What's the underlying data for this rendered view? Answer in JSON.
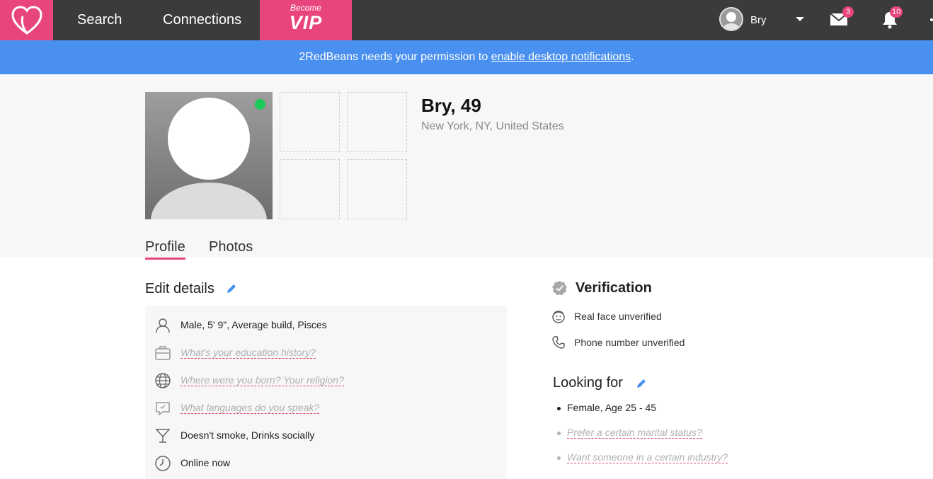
{
  "nav": {
    "logo_icon": "heart-logo-icon",
    "search_label": "Search",
    "connections_label": "Connections",
    "vip_small": "Become",
    "vip_big": "VIP",
    "user_name": "Bry",
    "messages_count": "3",
    "notifications_count": "10",
    "brand_color": "#e8457f",
    "bar_color": "#3b3b3b"
  },
  "banner": {
    "text_before": "2RedBeans needs your permission to ",
    "link_text": "enable desktop notifications",
    "text_after": ".",
    "color": "#4a90f0"
  },
  "profile": {
    "name_age": "Bry, 49",
    "location": "New York, NY, United States",
    "online": true
  },
  "tabs": [
    {
      "label": "Profile",
      "active": true
    },
    {
      "label": "Photos",
      "active": false
    }
  ],
  "details": {
    "title": "Edit details",
    "rows": [
      {
        "icon": "person-icon",
        "text": "Male, 5' 9\", Average build, Pisces",
        "prompt": false
      },
      {
        "icon": "briefcase-icon",
        "text": "What's your education history?",
        "prompt": true
      },
      {
        "icon": "globe-icon",
        "text": "Where were you born? Your religion?",
        "prompt": true
      },
      {
        "icon": "chat-bubble-icon",
        "text": "What languages do you speak?",
        "prompt": true
      },
      {
        "icon": "cocktail-icon",
        "text": "Doesn't smoke, Drinks socially",
        "prompt": false
      },
      {
        "icon": "clock-icon",
        "text": "Online now",
        "prompt": false
      }
    ]
  },
  "verification": {
    "title": "Verification",
    "items": [
      {
        "icon": "face-icon",
        "text": "Real face unverified"
      },
      {
        "icon": "phone-icon",
        "text": "Phone number unverified"
      }
    ]
  },
  "looking_for": {
    "title": "Looking for",
    "items": [
      {
        "text": "Female, Age 25 - 45",
        "prompt": false
      },
      {
        "text": "Prefer a certain marital status?",
        "prompt": true
      },
      {
        "text": "Want someone in a certain industry?",
        "prompt": true
      }
    ]
  }
}
